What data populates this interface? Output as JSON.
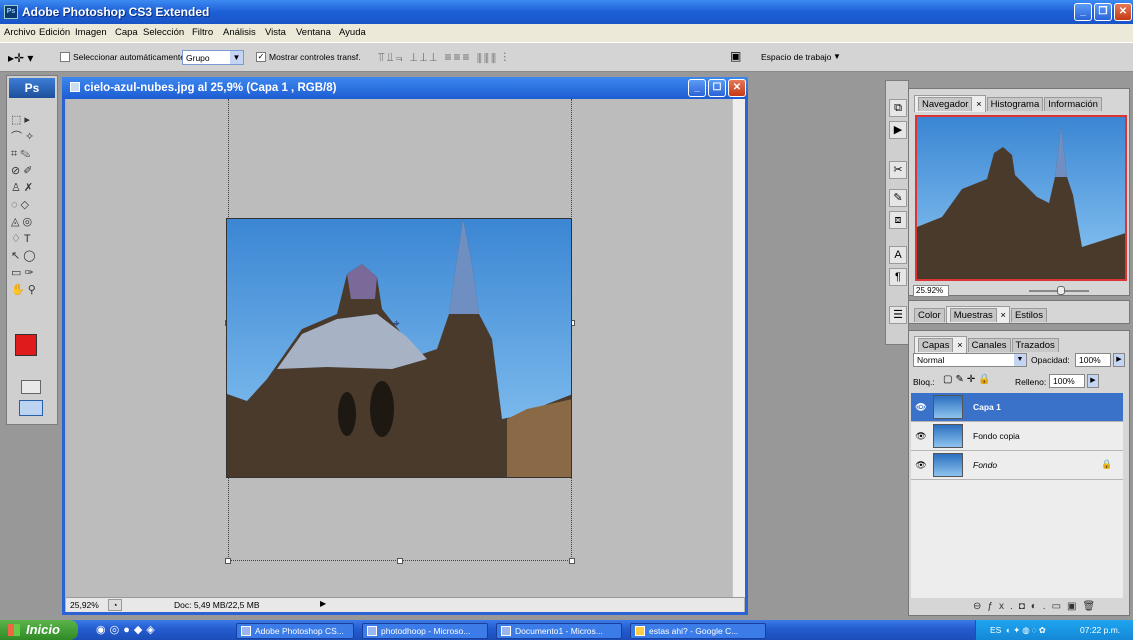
{
  "app": {
    "title": "Adobe Photoshop CS3 Extended",
    "ps_label": "Ps"
  },
  "menu": [
    "Archivo",
    "Edición",
    "Imagen",
    "Capa",
    "Selección",
    "Filtro",
    "Análisis",
    "Vista",
    "Ventana",
    "Ayuda"
  ],
  "options": {
    "auto_select_label": "Seleccionar automáticamente:",
    "auto_select_value": "Grupo",
    "show_transform_label": "Mostrar controles transf.",
    "workspace_label": "Espacio de trabajo"
  },
  "document": {
    "title": "cielo-azul-nubes.jpg al 25,9% (Capa 1 , RGB/8)",
    "zoom": "25,92%",
    "doc_info": "Doc: 5,49 MB/22,5 MB"
  },
  "navigator": {
    "tabs": [
      "Navegador",
      "Histograma",
      "Información"
    ],
    "zoom": "25.92%"
  },
  "swatches": {
    "tabs": [
      "Color",
      "Muestras",
      "Estilos"
    ]
  },
  "layers": {
    "tabs": [
      "Capas",
      "Canales",
      "Trazados"
    ],
    "blend_mode": "Normal",
    "opacity_label": "Opacidad:",
    "opacity": "100%",
    "lock_label": "Bloq.:",
    "fill_label": "Relleno:",
    "fill": "100%",
    "items": [
      {
        "name": "Capa 1",
        "selected": true
      },
      {
        "name": "Fondo copia",
        "selected": false
      },
      {
        "name": "Fondo",
        "selected": false,
        "locked": true
      }
    ]
  },
  "taskbar": {
    "start": "Inicio",
    "tasks": [
      "Adobe Photoshop CS...",
      "photodhoop - Microso...",
      "Documento1 - Micros...",
      "estas ahi? - Google C..."
    ],
    "lang": "ES",
    "time": "07:22 p.m."
  },
  "colors": {
    "foreground": "#e01b1b",
    "background": "#ffffff",
    "selection": "#3a71c9"
  }
}
